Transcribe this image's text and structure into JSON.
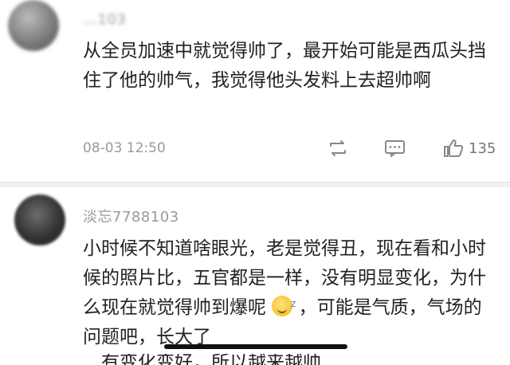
{
  "comments": [
    {
      "username": "…103",
      "text": "从全员加速中就觉得帅了，最开始可能是西瓜头挡住了他的帅气，我觉得他头发料上去超帅啊",
      "time": "08-03 12:50",
      "like_count": "135"
    },
    {
      "username": "淡忘7788103",
      "text_part1": "小时候不知道啥眼光，老是觉得丑，现在看和小时候的照片比，五官都是一样，没有明显变化，为什么现在就觉得帅到爆呢",
      "text_part2": "，可能是气质，气场的问题吧，长大了",
      "text_cutoff": "…有变化变好，所以越来越帅"
    }
  ],
  "icons": {
    "repost": "repost-icon",
    "reply": "reply-icon",
    "like": "thumbs-up-icon",
    "emoji": "sleepy-smile-emoji"
  }
}
